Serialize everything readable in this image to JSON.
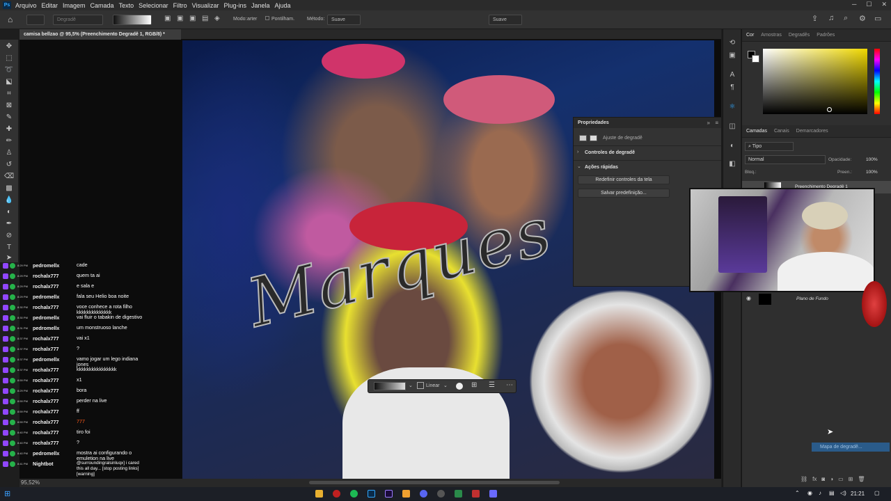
{
  "menubar": {
    "logo": "Ps",
    "items": [
      "Arquivo",
      "Editar",
      "Imagem",
      "Camada",
      "Texto",
      "Selecionar",
      "Filtro",
      "Visualizar",
      "Plug-ins",
      "Janela",
      "Ajuda"
    ]
  },
  "options": {
    "preset": "Degradê",
    "modo_label": "Modo:",
    "modo_value": "arter",
    "pontilham": "Pontilham.",
    "metodo_label": "Método:",
    "metodo_value": "Suave",
    "suave2": "Suave"
  },
  "document": {
    "tab_title": "camisa bellzao @ 95,5% (Preenchimento Degradê 1, RGB/8) *",
    "zoom": "95,52%",
    "artwork_text": "Marques"
  },
  "right_panel": {
    "color_tabs": [
      "Cor",
      "Amostras",
      "Degradês",
      "Padrões"
    ],
    "layer_tabs": [
      "Camadas",
      "Canais",
      "Demarcadores"
    ],
    "filter": "Tipo",
    "blend_mode": "Normal",
    "opacity_label": "Opacidade:",
    "opacity_value": "100%",
    "lock_label": "Bloq.:",
    "fill_label": "Preen.:",
    "fill_value": "100%",
    "layer_gradient_name": "Preenchimento Degradê 1",
    "layer_bg_name": "Plano de Fundo",
    "gradient_map_button": "Mapa de degradê..."
  },
  "properties": {
    "title": "Propriedades",
    "subtitle": "Ajuste de degradê",
    "section1": "Controles de degradê",
    "section2": "Ações rápidas",
    "btn_reset": "Redefinir controles da tela",
    "btn_save": "Salvar predefinição..."
  },
  "gradient_bar": {
    "type": "Linear"
  },
  "chat": [
    {
      "ts": "8:29 PM",
      "user": "pedromellx",
      "msg": "cade"
    },
    {
      "ts": "8:29 PM",
      "user": "rochalx777",
      "msg": "quem ta ai"
    },
    {
      "ts": "8:29 PM",
      "user": "rochalx777",
      "msg": "e sala e"
    },
    {
      "ts": "8:29 PM",
      "user": "pedromellx",
      "msg": "fala seu Helio boa noite"
    },
    {
      "ts": "8:30 PM",
      "user": "rochalx777",
      "msg": "voce conhece a rota filho kkkkkkkkkkkkkk"
    },
    {
      "ts": "8:30 PM",
      "user": "pedromellx",
      "msg": "vai fluir o tabakin de digestivo"
    },
    {
      "ts": "8:31 PM",
      "user": "pedromellx",
      "msg": "um monstruoso lanche"
    },
    {
      "ts": "8:37 PM",
      "user": "rochalx777",
      "msg": "vai x1"
    },
    {
      "ts": "8:37 PM",
      "user": "rochalx777",
      "msg": "?"
    },
    {
      "ts": "8:37 PM",
      "user": "pedromellx",
      "msg": "vamo jogar um lego indiana jones"
    },
    {
      "ts": "8:37 PM",
      "user": "rochalx777",
      "msg": "kkkkkkkkkkkkkkkk"
    },
    {
      "ts": "8:59 PM",
      "user": "rochalx777",
      "msg": "x1"
    },
    {
      "ts": "8:29 PM",
      "user": "rochalx777",
      "msg": "bora"
    },
    {
      "ts": "8:59 PM",
      "user": "rochalx777",
      "msg": "perder na live"
    },
    {
      "ts": "8:59 PM",
      "user": "rochalx777",
      "msg": "ff"
    },
    {
      "ts": "8:59 PM",
      "user": "rochalx777",
      "msg": "777"
    },
    {
      "ts": "8:40 PM",
      "user": "rochalx777",
      "msg": "tiro foi"
    },
    {
      "ts": "8:40 PM",
      "user": "rochalx777",
      "msg": "?"
    },
    {
      "ts": "8:40 PM",
      "user": "pedromellx",
      "msg": "mostra ai configurando o emuletion na live"
    },
    {
      "ts": "8:41 PM",
      "user": "Nightbot",
      "msg": "@surroundingralsinluqx] i cared this all day... [stop posting links] [warning]"
    }
  ],
  "taskbar": {
    "time": "21:21"
  },
  "colors": {
    "accent": "#31a8ff",
    "twitch": "#9147ff",
    "chat_badge": "#26b24a"
  }
}
